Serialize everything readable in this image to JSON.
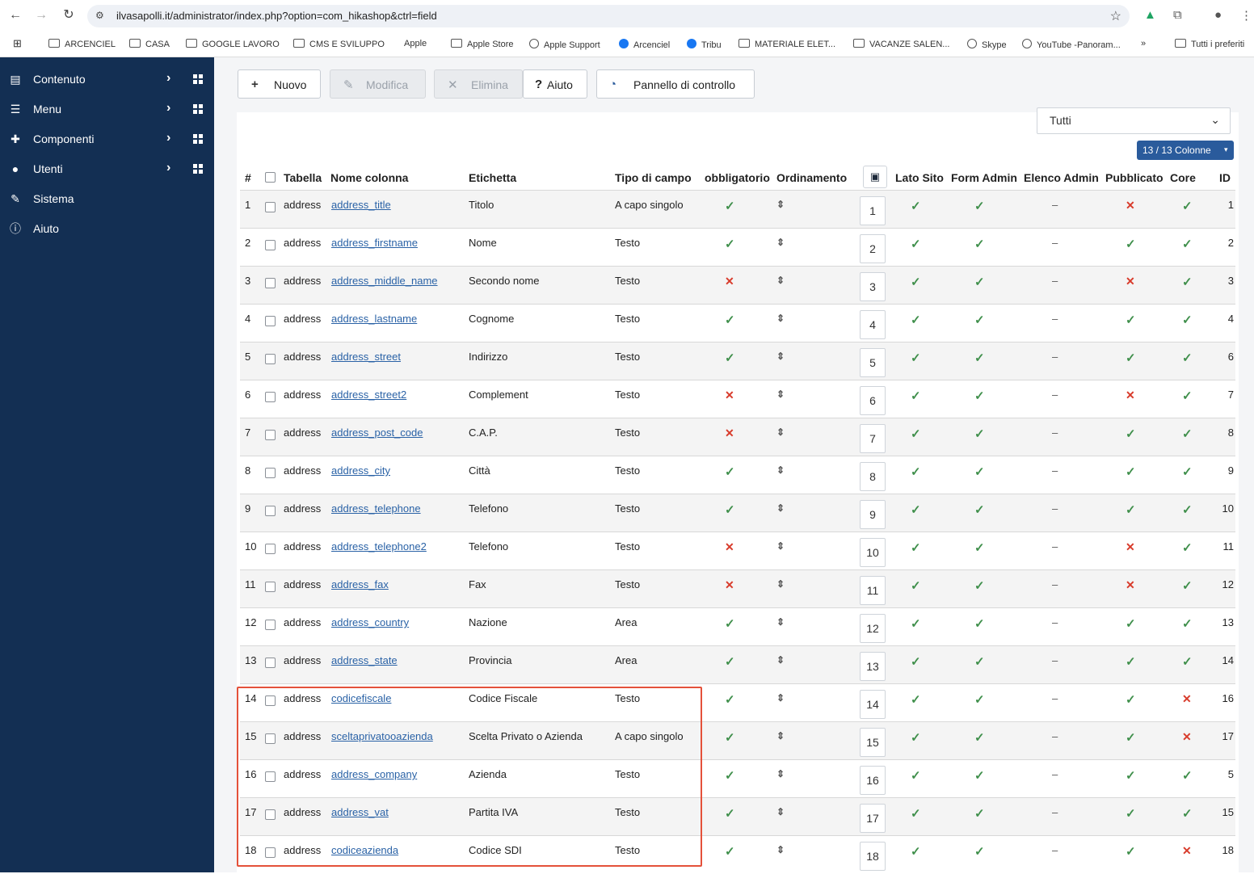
{
  "browser": {
    "url": "ilvasapolli.it/administrator/index.php?option=com_hikashop&ctrl=field",
    "bookmarks": [
      "ARCENCIEL",
      "CASA",
      "GOOGLE LAVORO",
      "CMS E SVILUPPO",
      "Apple",
      "Apple Store",
      "Apple Support",
      "Arcenciel",
      "Tribu",
      "MATERIALE ELET...",
      "VACANZE SALEN...",
      "Skype",
      "YouTube -Panoram...",
      "»",
      "Tutti i preferiti"
    ]
  },
  "sidebar": {
    "items": [
      {
        "label": "Contenuto",
        "icon": "file-icon"
      },
      {
        "label": "Menu",
        "icon": "list-icon"
      },
      {
        "label": "Componenti",
        "icon": "puzzle-icon"
      },
      {
        "label": "Utenti",
        "icon": "users-icon"
      },
      {
        "label": "Sistema",
        "icon": "wrench-icon"
      },
      {
        "label": "Aiuto",
        "icon": "info-icon"
      }
    ]
  },
  "toolbar": {
    "new_label": "Nuovo",
    "edit_label": "Modifica",
    "delete_label": "Elimina",
    "help_label": "Aiuto",
    "dashboard_label": "Pannello di controllo"
  },
  "filter": {
    "value": "Tutti"
  },
  "columns_button": {
    "label": "13 / 13  Colonne"
  },
  "table": {
    "headers": {
      "num": "#",
      "table": "Tabella",
      "column": "Nome colonna",
      "label": "Etichetta",
      "type": "Tipo di campo",
      "required": "obbligatorio",
      "ordering": "Ordinamento",
      "frontend": "Lato Sito",
      "admin_form": "Form Admin",
      "admin_list": "Elenco Admin",
      "published": "Pubblicato",
      "core": "Core",
      "id": "ID"
    },
    "rows": [
      {
        "n": "1",
        "table": "address",
        "column": "address_title",
        "label": "Titolo",
        "type": "A capo singolo",
        "required": true,
        "order": "1",
        "front": true,
        "form": true,
        "published": false,
        "core": true,
        "id": "1"
      },
      {
        "n": "2",
        "table": "address",
        "column": "address_firstname",
        "label": "Nome",
        "type": "Testo",
        "required": true,
        "order": "2",
        "front": true,
        "form": true,
        "published": true,
        "core": true,
        "id": "2"
      },
      {
        "n": "3",
        "table": "address",
        "column": "address_middle_name",
        "label": "Secondo nome",
        "type": "Testo",
        "required": false,
        "order": "3",
        "front": true,
        "form": true,
        "published": false,
        "core": true,
        "id": "3"
      },
      {
        "n": "4",
        "table": "address",
        "column": "address_lastname",
        "label": "Cognome",
        "type": "Testo",
        "required": true,
        "order": "4",
        "front": true,
        "form": true,
        "published": true,
        "core": true,
        "id": "4"
      },
      {
        "n": "5",
        "table": "address",
        "column": "address_street",
        "label": "Indirizzo",
        "type": "Testo",
        "required": true,
        "order": "5",
        "front": true,
        "form": true,
        "published": true,
        "core": true,
        "id": "6"
      },
      {
        "n": "6",
        "table": "address",
        "column": "address_street2",
        "label": "Complement",
        "type": "Testo",
        "required": false,
        "order": "6",
        "front": true,
        "form": true,
        "published": false,
        "core": true,
        "id": "7"
      },
      {
        "n": "7",
        "table": "address",
        "column": "address_post_code",
        "label": "C.A.P.",
        "type": "Testo",
        "required": false,
        "order": "7",
        "front": true,
        "form": true,
        "published": true,
        "core": true,
        "id": "8"
      },
      {
        "n": "8",
        "table": "address",
        "column": "address_city",
        "label": "Città",
        "type": "Testo",
        "required": true,
        "order": "8",
        "front": true,
        "form": true,
        "published": true,
        "core": true,
        "id": "9"
      },
      {
        "n": "9",
        "table": "address",
        "column": "address_telephone",
        "label": "Telefono",
        "type": "Testo",
        "required": true,
        "order": "9",
        "front": true,
        "form": true,
        "published": true,
        "core": true,
        "id": "10"
      },
      {
        "n": "10",
        "table": "address",
        "column": "address_telephone2",
        "label": "Telefono",
        "type": "Testo",
        "required": false,
        "order": "10",
        "front": true,
        "form": true,
        "published": false,
        "core": true,
        "id": "11"
      },
      {
        "n": "11",
        "table": "address",
        "column": "address_fax",
        "label": "Fax",
        "type": "Testo",
        "required": false,
        "order": "11",
        "front": true,
        "form": true,
        "published": false,
        "core": true,
        "id": "12"
      },
      {
        "n": "12",
        "table": "address",
        "column": "address_country",
        "label": "Nazione",
        "type": "Area",
        "required": true,
        "order": "12",
        "front": true,
        "form": true,
        "published": true,
        "core": true,
        "id": "13"
      },
      {
        "n": "13",
        "table": "address",
        "column": "address_state",
        "label": "Provincia",
        "type": "Area",
        "required": true,
        "order": "13",
        "front": true,
        "form": true,
        "published": true,
        "core": true,
        "id": "14"
      },
      {
        "n": "14",
        "table": "address",
        "column": "codicefiscale",
        "label": "Codice Fiscale",
        "type": "Testo",
        "required": true,
        "order": "14",
        "front": true,
        "form": true,
        "published": true,
        "core": false,
        "id": "16"
      },
      {
        "n": "15",
        "table": "address",
        "column": "sceltaprivatooazienda",
        "label": "Scelta Privato o Azienda",
        "type": "A capo singolo",
        "required": true,
        "order": "15",
        "front": true,
        "form": true,
        "published": true,
        "core": false,
        "id": "17"
      },
      {
        "n": "16",
        "table": "address",
        "column": "address_company",
        "label": "Azienda",
        "type": "Testo",
        "required": true,
        "order": "16",
        "front": true,
        "form": true,
        "published": true,
        "core": true,
        "id": "5"
      },
      {
        "n": "17",
        "table": "address",
        "column": "address_vat",
        "label": "Partita IVA",
        "type": "Testo",
        "required": true,
        "order": "17",
        "front": true,
        "form": true,
        "published": true,
        "core": true,
        "id": "15"
      },
      {
        "n": "18",
        "table": "address",
        "column": "codiceazienda",
        "label": "Codice SDI",
        "type": "Testo",
        "required": true,
        "order": "18",
        "front": true,
        "form": true,
        "published": true,
        "core": false,
        "id": "18"
      }
    ]
  },
  "colors": {
    "sidebar_bg": "#132f53",
    "check_green": "#3f8f4b",
    "cross_red": "#d83b2b",
    "link_blue": "#2a62a6",
    "highlight_red": "#e4513a"
  }
}
